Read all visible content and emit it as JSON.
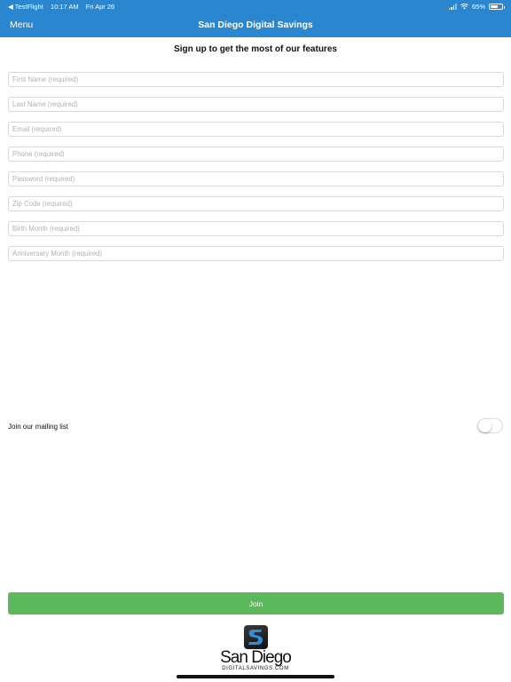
{
  "status_bar": {
    "back_app": "◀ TestFlight",
    "time": "10:17 AM",
    "date": "Fri Apr 26",
    "battery": "65%",
    "battery_level": 0.65
  },
  "nav": {
    "menu_label": "Menu",
    "title": "San Diego Digital Savings",
    "color": "#2a86cf"
  },
  "form": {
    "heading": "Sign up to get the most of our features",
    "fields": [
      {
        "placeholder": "First Name (required)",
        "value": ""
      },
      {
        "placeholder": "Last Name (required)",
        "value": ""
      },
      {
        "placeholder": "Email (required)",
        "value": ""
      },
      {
        "placeholder": "Phone (required)",
        "value": ""
      },
      {
        "placeholder": "Password (required)",
        "value": ""
      },
      {
        "placeholder": "Zip Code (required)",
        "value": ""
      },
      {
        "placeholder": "Birth Month (required)",
        "value": ""
      },
      {
        "placeholder": "Anniversary Month (required)",
        "value": ""
      }
    ],
    "mailing_list_label": "Join our mailing list",
    "mailing_list_on": false,
    "join_label": "Join",
    "join_color": "#5cb85c"
  },
  "logo": {
    "name": "San Diego",
    "sub": "DIGITALSAVINGS.COM",
    "mark_letter": "S"
  }
}
